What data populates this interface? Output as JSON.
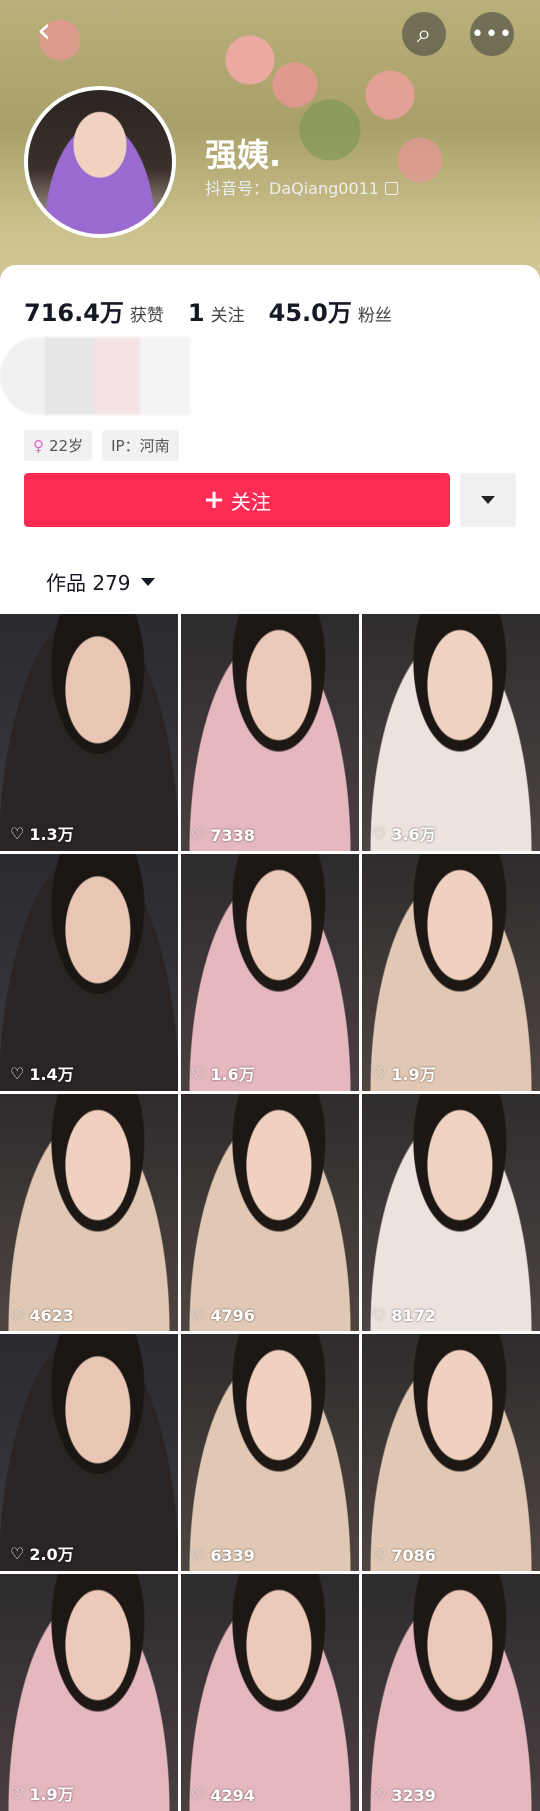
{
  "header": {
    "back_glyph": "‹",
    "search_glyph": "⌕",
    "more_glyph": "•••",
    "name": "强姨.",
    "douyin_id": "抖音号：DaQiang0011"
  },
  "profile": {
    "stats": [
      {
        "value": "716.4万",
        "label": "获赞"
      },
      {
        "value": "1",
        "label": "关注"
      },
      {
        "value": "45.0万",
        "label": "粉丝"
      }
    ],
    "tags": [
      {
        "icon": "female-icon",
        "glyph": "♀",
        "text": "22岁"
      },
      {
        "text": "IP：河南"
      }
    ],
    "follow_label": "关注",
    "follow_plus": "+",
    "works_label": "作品 279"
  },
  "colors": {
    "follow_button": "#fe2c55",
    "tag_bg": "#f1f1f2",
    "text_primary": "#161823"
  },
  "videos": [
    {
      "likes": "1.3万",
      "style": "night"
    },
    {
      "likes": "7338",
      "style": "pink"
    },
    {
      "likes": "3.6万",
      "style": "white"
    },
    {
      "likes": "1.4万",
      "style": "night"
    },
    {
      "likes": "1.6万",
      "style": "pink"
    },
    {
      "likes": "1.9万",
      "style": "lace"
    },
    {
      "likes": "4623",
      "style": "lace"
    },
    {
      "likes": "4796",
      "style": "lace"
    },
    {
      "likes": "8172",
      "style": "white"
    },
    {
      "likes": "2.0万",
      "style": "night"
    },
    {
      "likes": "6339",
      "style": "lace"
    },
    {
      "likes": "7086",
      "style": "lace"
    },
    {
      "likes": "1.9万",
      "style": "pink"
    },
    {
      "likes": "4294",
      "style": "pink"
    },
    {
      "likes": "3239",
      "style": "pink"
    }
  ]
}
